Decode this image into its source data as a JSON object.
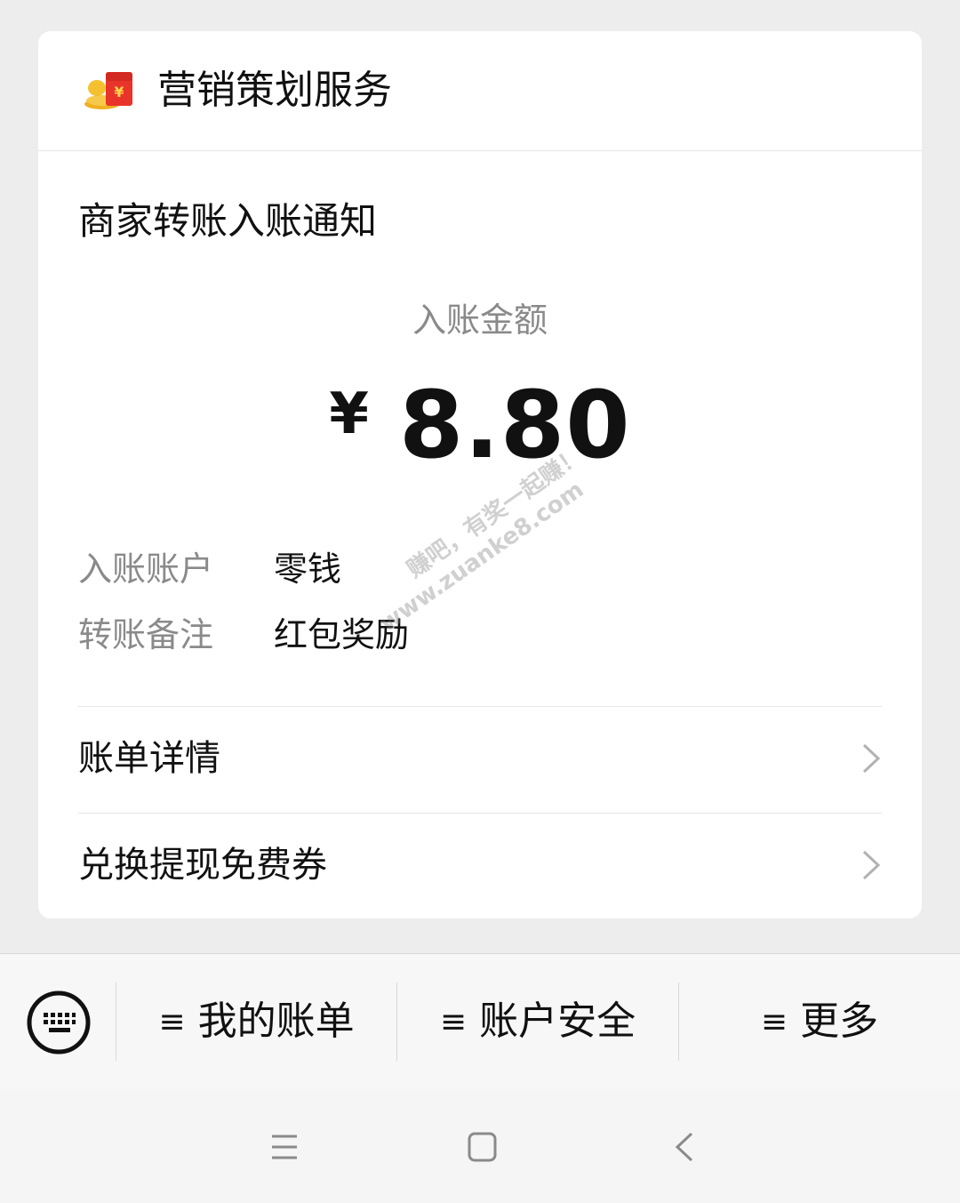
{
  "header": {
    "service_name": "营销策划服务",
    "logo_icon": "red-packet-icon"
  },
  "notice": {
    "title": "商家转账入账通知",
    "amount_label": "入账金额",
    "currency_symbol": "¥",
    "amount": "8.80"
  },
  "info": [
    {
      "key": "入账账户",
      "value": "零钱"
    },
    {
      "key": "转账备注",
      "value": "红包奖励"
    }
  ],
  "watermark": {
    "line1": "赚吧，有奖一起赚！",
    "line2": "www.zuanke8.com"
  },
  "links": [
    {
      "label": "账单详情",
      "icon": "chevron-right-icon"
    },
    {
      "label": "兑换提现免费券",
      "icon": "chevron-right-icon"
    }
  ],
  "bottom_menu": {
    "keyboard_icon": "keyboard-icon",
    "items": [
      {
        "bars": "≡",
        "label": "我的账单"
      },
      {
        "bars": "≡",
        "label": "账户安全"
      },
      {
        "bars": "≡",
        "label": "更多"
      }
    ]
  },
  "nav": {
    "icons": [
      "menu-icon",
      "home-icon",
      "back-icon"
    ]
  },
  "colors": {
    "background": "#ededed",
    "card": "#ffffff",
    "secondary_text": "#8a8a8a",
    "primary_text": "#111111"
  }
}
